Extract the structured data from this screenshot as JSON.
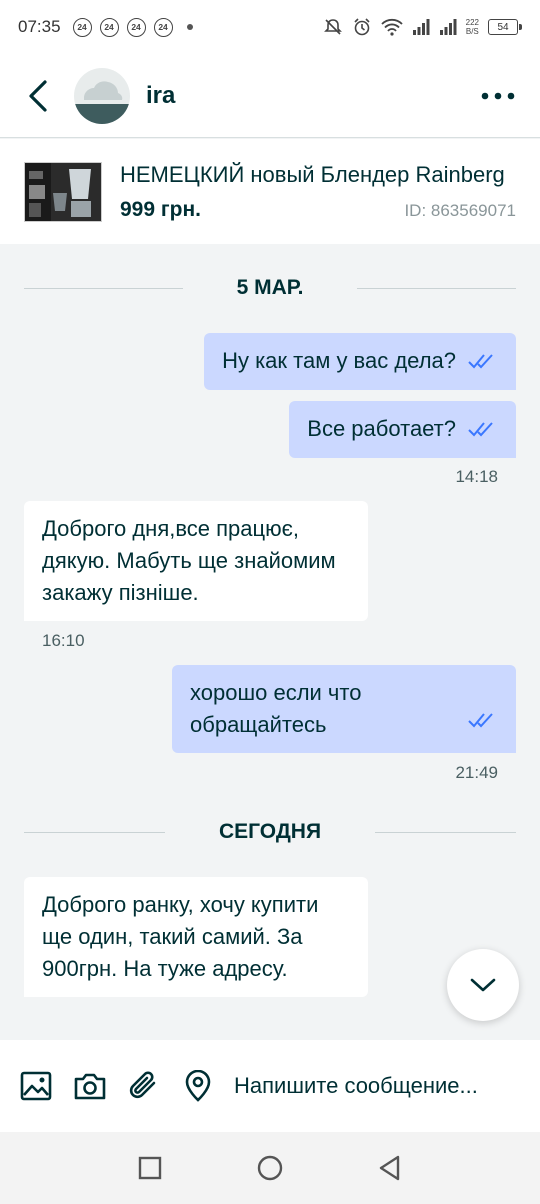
{
  "status_bar": {
    "time": "07:35",
    "notifications": [
      "24",
      "24",
      "24",
      "24"
    ],
    "net_speed_value": "222",
    "net_speed_unit": "B/S",
    "battery": "54"
  },
  "header": {
    "user_name": "ira"
  },
  "ad": {
    "title": "НЕМЕЦКИЙ новый Блендер Rainberg",
    "price": "999 грн.",
    "id": "ID: 863569071"
  },
  "dates": {
    "first": "5 МАР.",
    "today": "СЕГОДНЯ"
  },
  "messages": [
    {
      "direction": "out",
      "text": "Ну как там у вас дела?",
      "read": true
    },
    {
      "direction": "out",
      "text": "Все работает?",
      "read": true,
      "time": "14:18"
    },
    {
      "direction": "in",
      "text": "Доброго дня,все працює, дякую. Мабуть ще знайомим закажу пізніше.",
      "time": "16:10"
    },
    {
      "direction": "out",
      "text": "хорошо если что обращайтесь",
      "read": true,
      "time": "21:49"
    },
    {
      "direction": "in",
      "text": "Доброго ранку, хочу купити ще один, такий самий. За 900грн. На туже адресу."
    }
  ],
  "composer": {
    "placeholder": "Напишите сообщение..."
  },
  "colors": {
    "outgoing_bubble": "#cbd8ff",
    "incoming_bubble": "#ffffff",
    "text": "#002f34",
    "tick": "#3a77ff"
  }
}
